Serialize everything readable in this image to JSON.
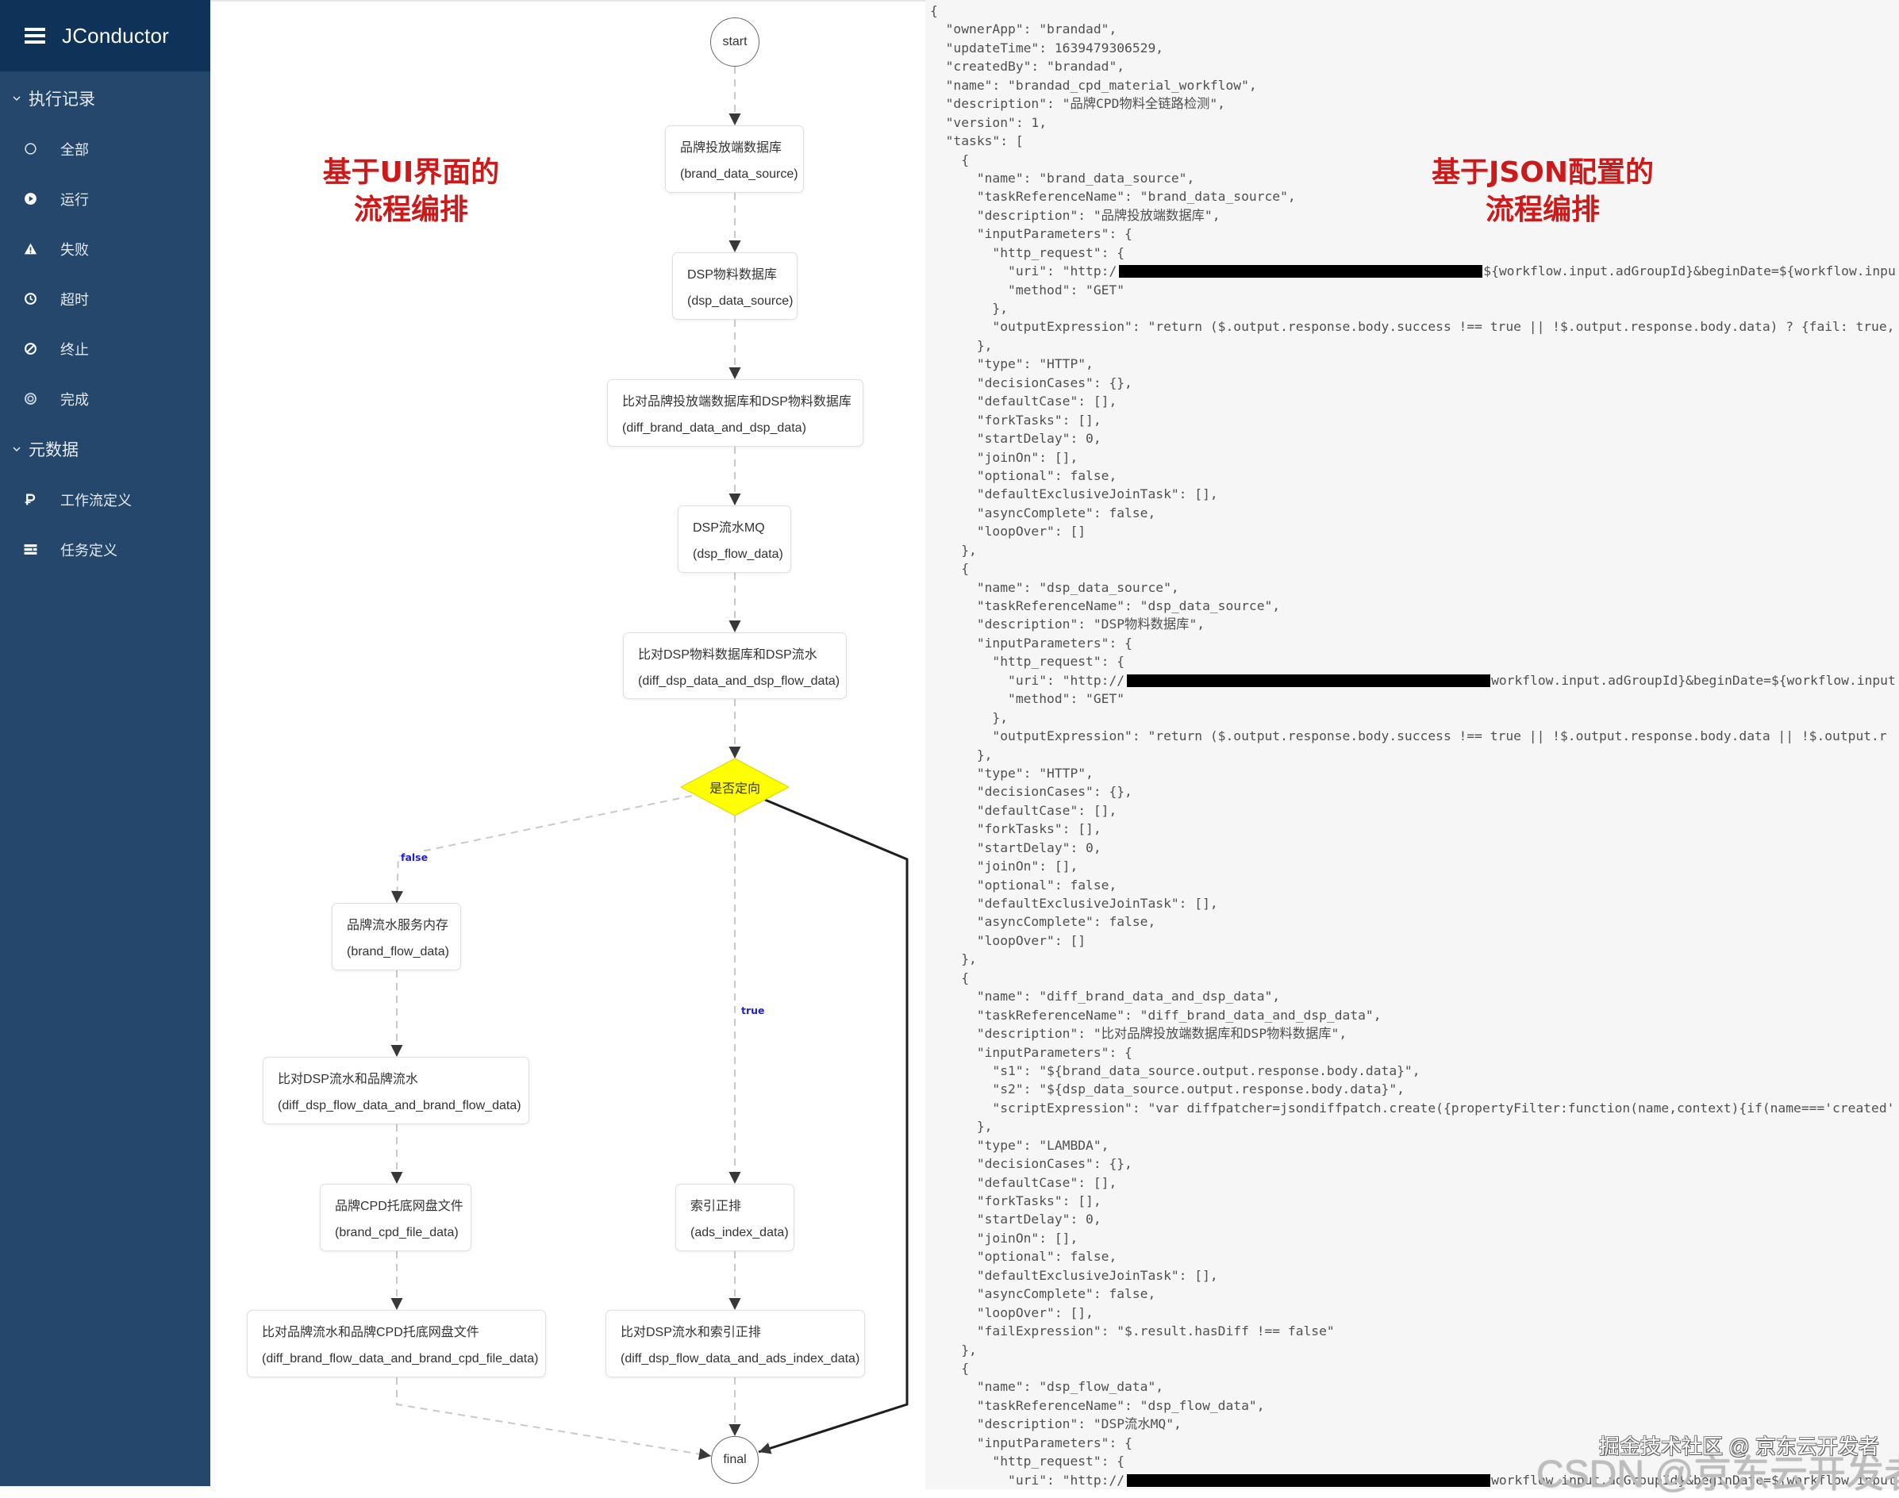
{
  "app": {
    "title": "JConductor"
  },
  "sidebar": {
    "sections": [
      {
        "label": "执行记录",
        "expanded": true,
        "items": [
          {
            "label": "全部",
            "icon": "circle-outline-icon"
          },
          {
            "label": "运行",
            "icon": "play-circle-icon"
          },
          {
            "label": "失败",
            "icon": "warning-icon"
          },
          {
            "label": "超时",
            "icon": "clock-icon"
          },
          {
            "label": "终止",
            "icon": "ban-icon"
          },
          {
            "label": "完成",
            "icon": "bullseye-icon"
          }
        ]
      },
      {
        "label": "元数据",
        "expanded": true,
        "items": [
          {
            "label": "工作流定义",
            "icon": "workflow-icon"
          },
          {
            "label": "任务定义",
            "icon": "task-list-icon"
          }
        ]
      }
    ]
  },
  "diagram": {
    "annotation": [
      "基于UI界面的",
      "流程编排"
    ],
    "nodes": [
      {
        "id": "start",
        "type": "terminal",
        "label": "start"
      },
      {
        "id": "brand_data_source",
        "type": "task",
        "label": "品牌投放端数据库",
        "ref": "(brand_data_source)"
      },
      {
        "id": "dsp_data_source",
        "type": "task",
        "label": "DSP物料数据库",
        "ref": "(dsp_data_source)"
      },
      {
        "id": "diff_brand_data_and_dsp_data",
        "type": "task",
        "label": "比对品牌投放端数据库和DSP物料数据库",
        "ref": "(diff_brand_data_and_dsp_data)"
      },
      {
        "id": "dsp_flow_data",
        "type": "task",
        "label": "DSP流水MQ",
        "ref": "(dsp_flow_data)"
      },
      {
        "id": "diff_dsp_data_and_dsp_flow_data",
        "type": "task",
        "label": "比对DSP物料数据库和DSP流水",
        "ref": "(diff_dsp_data_and_dsp_flow_data)"
      },
      {
        "id": "decision",
        "type": "decision",
        "label": "是否定向"
      },
      {
        "id": "brand_flow_data",
        "type": "task",
        "label": "品牌流水服务内存",
        "ref": "(brand_flow_data)"
      },
      {
        "id": "diff_dsp_flow_data_and_brand_flow_data",
        "type": "task",
        "label": "比对DSP流水和品牌流水",
        "ref": "(diff_dsp_flow_data_and_brand_flow_data)"
      },
      {
        "id": "brand_cpd_file_data",
        "type": "task",
        "label": "品牌CPD托底网盘文件",
        "ref": "(brand_cpd_file_data)"
      },
      {
        "id": "diff_brand_flow_data_and_brand_cpd_file_data",
        "type": "task",
        "label": "比对品牌流水和品牌CPD托底网盘文件",
        "ref": "(diff_brand_flow_data_and_brand_cpd_file_data)"
      },
      {
        "id": "ads_index_data",
        "type": "task",
        "label": "索引正排",
        "ref": "(ads_index_data)"
      },
      {
        "id": "diff_dsp_flow_data_and_ads_index_data",
        "type": "task",
        "label": "比对DSP流水和索引正排",
        "ref": "(diff_dsp_flow_data_and_ads_index_data)"
      },
      {
        "id": "final",
        "type": "terminal",
        "label": "final"
      }
    ],
    "edges": [
      {
        "from": "start",
        "to": "brand_data_source",
        "style": "dashed"
      },
      {
        "from": "brand_data_source",
        "to": "dsp_data_source",
        "style": "dashed"
      },
      {
        "from": "dsp_data_source",
        "to": "diff_brand_data_and_dsp_data",
        "style": "dashed"
      },
      {
        "from": "diff_brand_data_and_dsp_data",
        "to": "dsp_flow_data",
        "style": "dashed"
      },
      {
        "from": "dsp_flow_data",
        "to": "diff_dsp_data_and_dsp_flow_data",
        "style": "dashed"
      },
      {
        "from": "diff_dsp_data_and_dsp_flow_data",
        "to": "decision",
        "style": "dashed"
      },
      {
        "from": "decision",
        "to": "brand_flow_data",
        "style": "dashed",
        "label": "false"
      },
      {
        "from": "decision",
        "to": "ads_index_data",
        "style": "dashed",
        "label": "true"
      },
      {
        "from": "decision",
        "to": "final",
        "style": "solid"
      },
      {
        "from": "brand_flow_data",
        "to": "diff_dsp_flow_data_and_brand_flow_data",
        "style": "dashed"
      },
      {
        "from": "diff_dsp_flow_data_and_brand_flow_data",
        "to": "brand_cpd_file_data",
        "style": "dashed"
      },
      {
        "from": "brand_cpd_file_data",
        "to": "diff_brand_flow_data_and_brand_cpd_file_data",
        "style": "dashed"
      },
      {
        "from": "diff_brand_flow_data_and_brand_cpd_file_data",
        "to": "final",
        "style": "dashed"
      },
      {
        "from": "ads_index_data",
        "to": "diff_dsp_flow_data_and_ads_index_data",
        "style": "dashed"
      },
      {
        "from": "diff_dsp_flow_data_and_ads_index_data",
        "to": "final",
        "style": "dashed"
      }
    ]
  },
  "json_panel": {
    "annotation": [
      "基于JSON配置的",
      "流程编排"
    ],
    "lines": [
      "{",
      "  \"ownerApp\": \"brandad\",",
      "  \"updateTime\": 1639479306529,",
      "  \"createdBy\": \"brandad\",",
      "  \"name\": \"brandad_cpd_material_workflow\",",
      "  \"description\": \"品牌CPD物料全链路检测\",",
      "  \"version\": 1,",
      "  \"tasks\": [",
      "    {",
      "      \"name\": \"brand_data_source\",",
      "      \"taskReferenceName\": \"brand_data_source\",",
      "      \"description\": \"品牌投放端数据库\",",
      "      \"inputParameters\": {",
      "        \"http_request\": {",
      {
        "before": "          \"uri\": \"http:/",
        "redacted": true,
        "after": "${workflow.input.adGroupId}&beginDate=${workflow.inpu"
      },
      "          \"method\": \"GET\"",
      "        },",
      "        \"outputExpression\": \"return ($.output.response.body.success !== true || !$.output.response.body.data) ? {fail: true,",
      "      },",
      "      \"type\": \"HTTP\",",
      "      \"decisionCases\": {},",
      "      \"defaultCase\": [],",
      "      \"forkTasks\": [],",
      "      \"startDelay\": 0,",
      "      \"joinOn\": [],",
      "      \"optional\": false,",
      "      \"defaultExclusiveJoinTask\": [],",
      "      \"asyncComplete\": false,",
      "      \"loopOver\": []",
      "    },",
      "    {",
      "      \"name\": \"dsp_data_source\",",
      "      \"taskReferenceName\": \"dsp_data_source\",",
      "      \"description\": \"DSP物料数据库\",",
      "      \"inputParameters\": {",
      "        \"http_request\": {",
      {
        "before": "          \"uri\": \"http://",
        "redacted": true,
        "after": "workflow.input.adGroupId}&beginDate=${workflow.input"
      },
      "          \"method\": \"GET\"",
      "        },",
      "        \"outputExpression\": \"return ($.output.response.body.success !== true || !$.output.response.body.data || !$.output.r",
      "      },",
      "      \"type\": \"HTTP\",",
      "      \"decisionCases\": {},",
      "      \"defaultCase\": [],",
      "      \"forkTasks\": [],",
      "      \"startDelay\": 0,",
      "      \"joinOn\": [],",
      "      \"optional\": false,",
      "      \"defaultExclusiveJoinTask\": [],",
      "      \"asyncComplete\": false,",
      "      \"loopOver\": []",
      "    },",
      "    {",
      "      \"name\": \"diff_brand_data_and_dsp_data\",",
      "      \"taskReferenceName\": \"diff_brand_data_and_dsp_data\",",
      "      \"description\": \"比对品牌投放端数据库和DSP物料数据库\",",
      "      \"inputParameters\": {",
      "        \"s1\": \"${brand_data_source.output.response.body.data}\",",
      "        \"s2\": \"${dsp_data_source.output.response.body.data}\",",
      "        \"scriptExpression\": \"var diffpatcher=jsondiffpatch.create({propertyFilter:function(name,context){if(name==='created'",
      "      },",
      "      \"type\": \"LAMBDA\",",
      "      \"decisionCases\": {},",
      "      \"defaultCase\": [],",
      "      \"forkTasks\": [],",
      "      \"startDelay\": 0,",
      "      \"joinOn\": [],",
      "      \"optional\": false,",
      "      \"defaultExclusiveJoinTask\": [],",
      "      \"asyncComplete\": false,",
      "      \"loopOver\": [],",
      "      \"failExpression\": \"$.result.hasDiff !== false\"",
      "    },",
      "    {",
      "      \"name\": \"dsp_flow_data\",",
      "      \"taskReferenceName\": \"dsp_flow_data\",",
      "      \"description\": \"DSP流水MQ\",",
      "      \"inputParameters\": {",
      "        \"http_request\": {",
      {
        "before": "          \"uri\": \"http://",
        "redacted": true,
        "after": "workflow.input.adGroupId}&beginDate=${workflow.input"
      }
    ]
  },
  "watermarks": [
    "掘金技术社区 @ 京东云开发者",
    "CSDN @京东云开发者"
  ],
  "colors": {
    "sidebar_header": "#0e3258",
    "sidebar_bg": "#24476b",
    "decision_fill": "#ffff00",
    "annotation_red": "#cc1a1a",
    "edge_label_blue": "#1f1fd6",
    "json_panel_bg": "#f6f6f6",
    "redaction": "#000000"
  }
}
